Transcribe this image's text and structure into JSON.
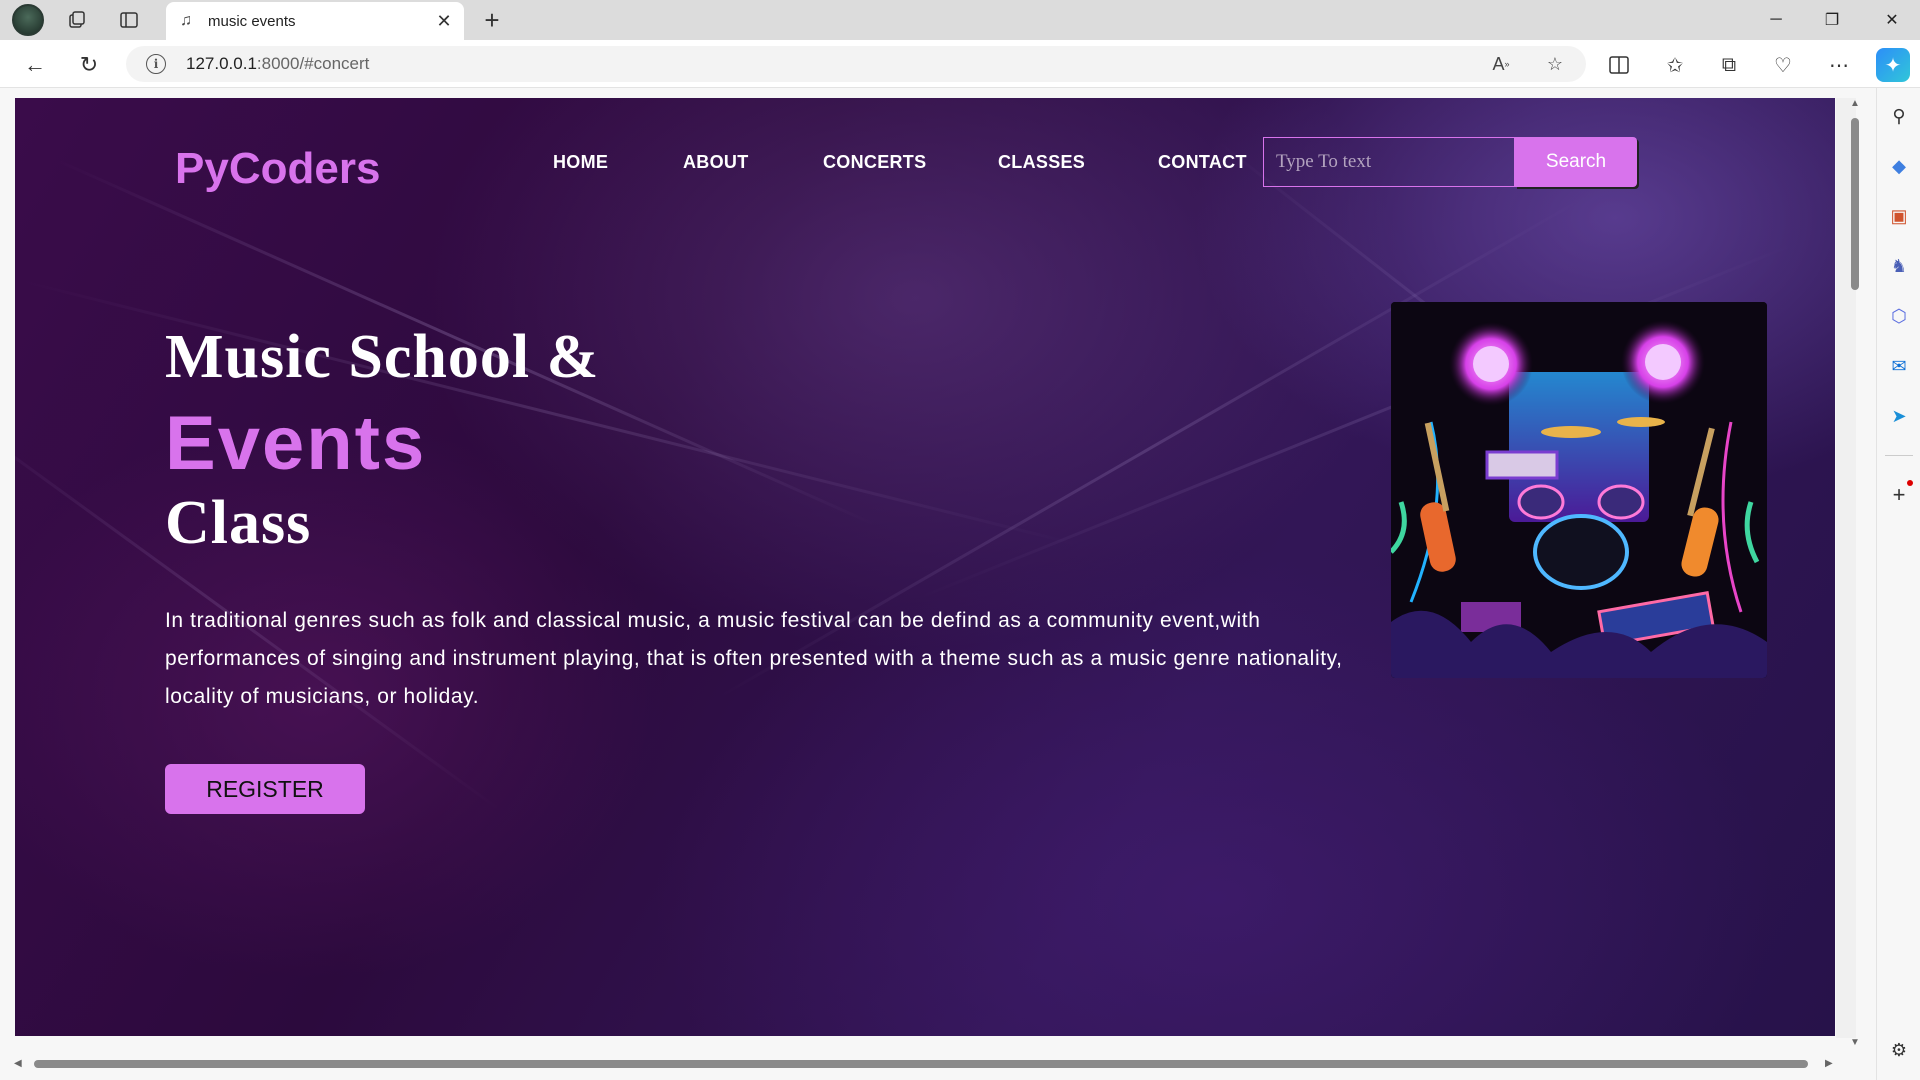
{
  "browser": {
    "tab_title": "music events",
    "url_host": "127.0.0.1",
    "url_rest": ":8000/#concert",
    "new_tab": "+",
    "close": "✕"
  },
  "site": {
    "logo": "PyCoders",
    "nav": [
      "HOME",
      "ABOUT",
      "CONCERTS",
      "CLASSES",
      "CONTACT"
    ],
    "search_placeholder": "Type To text",
    "search_button": "Search"
  },
  "hero": {
    "line1": "Music School &",
    "line2": "Events",
    "line3": "Class",
    "description": "In traditional genres such as folk and classical music, a music festival can be defind as a community event,with performances of singing and instrument playing, that is often presented with a theme such as a music genre nationality, locality of musicians, or holiday.",
    "register_button": "REGISTER"
  },
  "colors": {
    "accent": "#d873ec",
    "background": "#2c0a3d"
  }
}
